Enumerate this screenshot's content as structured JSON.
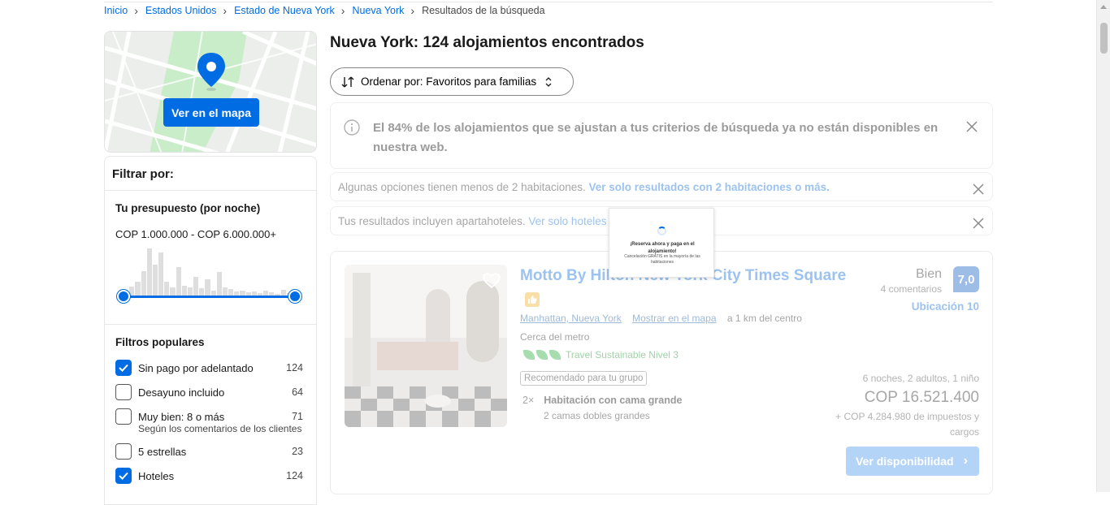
{
  "breadcrumb": {
    "items": [
      "Inicio",
      "Estados Unidos",
      "Estado de Nueva York",
      "Nueva York"
    ],
    "current": "Resultados de la búsqueda"
  },
  "map": {
    "button_label": "Ver en el mapa"
  },
  "filters": {
    "heading": "Filtrar por:",
    "budget": {
      "title": "Tu presupuesto (por noche)",
      "range": "COP 1.000.000 - COP 6.000.000+",
      "histogram": [
        0.12,
        0.2,
        0.3,
        0.52,
        0.98,
        0.65,
        0.9,
        0.3,
        0.18,
        0.6,
        0.22,
        0.18,
        0.4,
        0.16,
        0.35,
        0.12,
        0.5,
        0.18,
        0.15,
        0.1,
        0.12,
        0.08,
        0.1,
        0.06,
        0.12,
        0.08,
        0.05,
        0.14,
        0.06,
        0.1
      ]
    },
    "popular": {
      "title": "Filtros populares",
      "items": [
        {
          "label": "Sin pago por adelantado",
          "count": "124",
          "checked": true
        },
        {
          "label": "Desayuno incluido",
          "count": "64",
          "checked": false
        },
        {
          "label": "Muy bien: 8 o más",
          "count": "71",
          "checked": false,
          "note": "Según los comentarios de los clientes"
        },
        {
          "label": "5 estrellas",
          "count": "23",
          "checked": false
        },
        {
          "label": "Hoteles",
          "count": "124",
          "checked": true
        }
      ]
    }
  },
  "results": {
    "title": "Nueva York: 124 alojamientos encontrados",
    "sort_label": "Ordenar por: Favoritos para familias"
  },
  "notices": {
    "availability": "El 84% de los alojamientos que se ajustan a tus criterios de búsqueda ya no están disponibles en nuestra web.",
    "rooms_text": "Algunas opciones tienen menos de 2 habitaciones.",
    "rooms_link": "Ver solo resultados con 2 habitaciones o más.",
    "aparthotel_text": "Tus resultados incluyen apartahoteles.",
    "aparthotel_link": "Ver solo hoteles"
  },
  "hotel": {
    "name": "Motto By Hilton New York City Times Square",
    "location": "Manhattan, Nueva York",
    "show_map": "Mostrar en el mapa",
    "distance": "a 1 km del centro",
    "metro": "Cerca del metro",
    "sustainable": "Travel Sustainable Nivel 3",
    "recommended": "Recomendado para tu grupo",
    "room_qty": "2×",
    "room_type": "Habitación con cama grande",
    "beds": "2 camas dobles grandes",
    "score_word": "Bien",
    "reviews": "4 comentarios",
    "score": "7,0",
    "location_score": "Ubicación 10",
    "stay": "6 noches, 2 adultos, 1 niño",
    "price": "COP 16.521.400",
    "taxes": "+ COP 4.284.980 de impuestos y cargos",
    "cta": "Ver disponibilidad"
  },
  "popup": {
    "title": "¡Reserva ahora y paga en el alojamiento!",
    "body": "Cancelación GRATIS en la mayoría de las habitaciones"
  },
  "colors": {
    "accent": "#006ce4"
  }
}
